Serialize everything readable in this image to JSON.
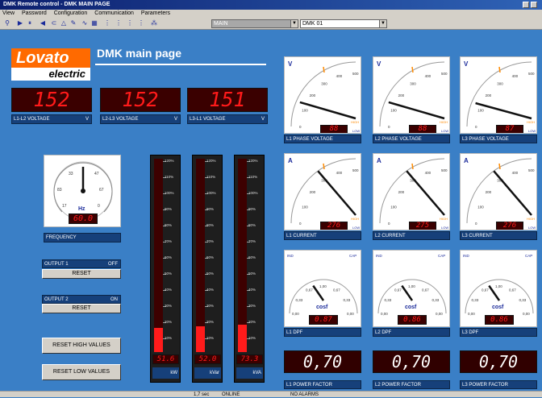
{
  "window": {
    "title": "DMK Remote control - DMK MAIN PAGE"
  },
  "menu": [
    "View",
    "Password",
    "Configuration",
    "Communication",
    "Parameters"
  ],
  "toolbar": {
    "combo1": "MAIN",
    "combo2": "DMK 01"
  },
  "logo": {
    "top": "Lovato",
    "bottom": "electric"
  },
  "page_title": "DMK main page",
  "voltages": [
    {
      "value": "152",
      "label": "L1-L2 VOLTAGE",
      "unit": "V"
    },
    {
      "value": "152",
      "label": "L2-L3 VOLTAGE",
      "unit": "V"
    },
    {
      "value": "151",
      "label": "L3-L1 VOLTAGE",
      "unit": "V"
    }
  ],
  "frequency": {
    "label": "FREQUENCY",
    "unit": "Hz",
    "value": "60.0",
    "ticks": [
      "33",
      "47",
      "67",
      "83",
      "17",
      "0",
      "100"
    ],
    "level": 0.5
  },
  "outputs": [
    {
      "label": "OUTPUT 1",
      "state": "OFF",
      "reset": "RESET"
    },
    {
      "label": "OUTPUT 2",
      "state": "ON",
      "reset": "RESET"
    }
  ],
  "buttons": {
    "reset_high": "RESET HIGH VALUES",
    "reset_low": "RESET LOW VALUES"
  },
  "bars": {
    "ticks": [
      "120%",
      "110%",
      "100%",
      "90%",
      "80%",
      "70%",
      "60%",
      "50%",
      "40%",
      "30%",
      "20%",
      "10%"
    ],
    "items": [
      {
        "value": "51.6",
        "unit": "kW",
        "fill_percent": 15
      },
      {
        "value": "52.0",
        "unit": "kVar",
        "fill_percent": 16
      },
      {
        "value": "73.3",
        "unit": "kVA",
        "fill_percent": 17
      }
    ]
  },
  "phase_voltage": {
    "ticks": [
      "0",
      "100",
      "200",
      "300",
      "400",
      "500"
    ],
    "symbol": "V",
    "low": "LOW",
    "high": "HIGH",
    "items": [
      {
        "label": "L1 PHASE VOLTAGE",
        "value": "88",
        "level": 0.18
      },
      {
        "label": "L2 PHASE VOLTAGE",
        "value": "88",
        "level": 0.18
      },
      {
        "label": "L3 PHASE VOLTAGE",
        "value": "87",
        "level": 0.17
      }
    ]
  },
  "current": {
    "ticks": [
      "0",
      "100",
      "200",
      "300",
      "400",
      "500"
    ],
    "symbol": "A",
    "low": "LOW",
    "high": "HIGH",
    "items": [
      {
        "label": "L1 CURRENT",
        "value": "276",
        "level": 0.55
      },
      {
        "label": "L2 CURRENT",
        "value": "275",
        "level": 0.55
      },
      {
        "label": "L3 CURRENT",
        "value": "276",
        "level": 0.55
      }
    ]
  },
  "dpf": {
    "ticks": [
      "0,00",
      "0,33",
      "0,67",
      "1,00",
      "0,67",
      "0,33",
      "0,00"
    ],
    "ind": "IND",
    "cap": "CAP",
    "symbol": "cosf",
    "items": [
      {
        "label": "L1 DPF",
        "value": "0.87",
        "level": 0.37
      },
      {
        "label": "L2 DPF",
        "value": "0.86",
        "level": 0.37
      },
      {
        "label": "L3 DPF",
        "value": "0.86",
        "level": 0.37
      }
    ]
  },
  "power_factor": [
    {
      "label": "L1 POWER FACTOR",
      "value": "0,70"
    },
    {
      "label": "L2 POWER FACTOR",
      "value": "0,70"
    },
    {
      "label": "L3 POWER FACTOR",
      "value": "0,70"
    }
  ],
  "statusbar": {
    "interval": "1,7 sec",
    "link": "ONLINE",
    "alarms": "NO ALARMS"
  }
}
